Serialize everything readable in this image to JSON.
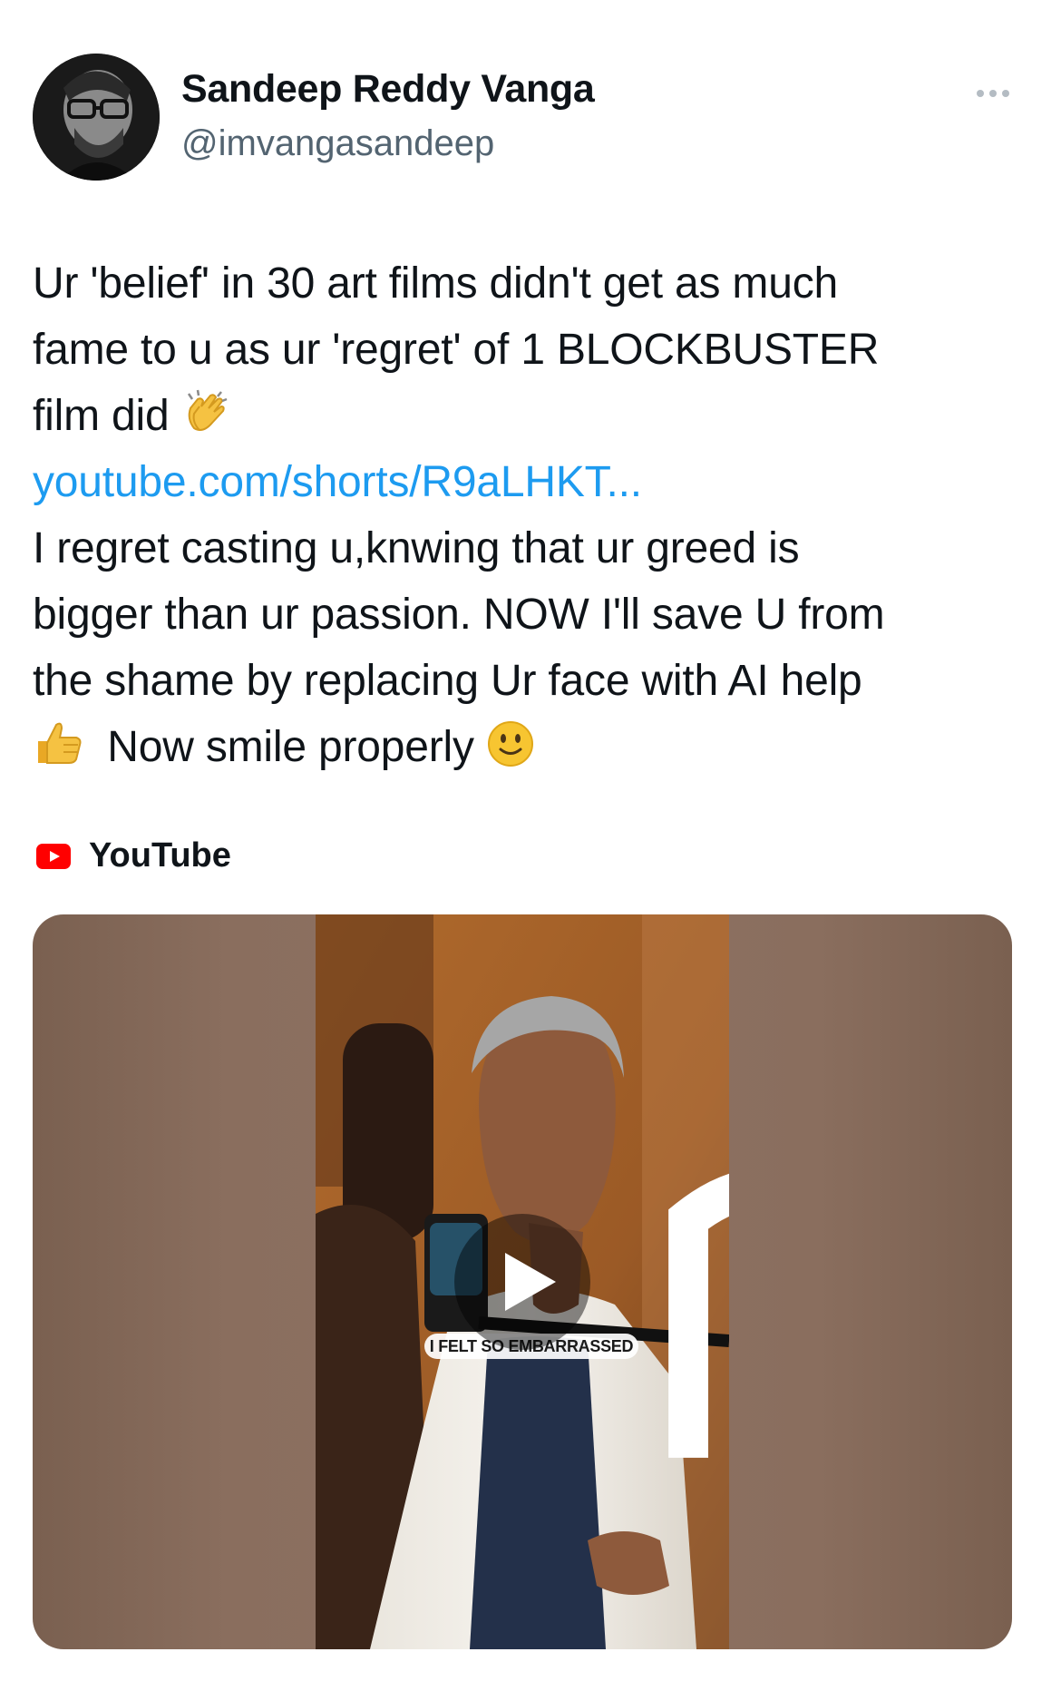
{
  "author": {
    "display_name": "Sandeep Reddy Vanga",
    "handle": "@imvangasandeep"
  },
  "tweet": {
    "lines": [
      "Ur 'belief' in 30 art films didn't get as much",
      "fame to u as ur 'regret' of 1 BLOCKBUSTER",
      "film did"
    ],
    "link_text": "youtube.com/shorts/R9aLHKT...",
    "lines_after": [
      "I regret casting u,knwing that ur greed is",
      "bigger than ur passion. NOW I'll save U from",
      "the shame by replacing Ur face with AI help"
    ],
    "last_line": "Now smile properly",
    "emojis": [
      "clapping-hands",
      "thumbs-up",
      "slightly-smiling-face"
    ]
  },
  "card": {
    "source_label": "YouTube",
    "video_caption": "I FELT SO EMBARRASSED",
    "icon": "play-icon"
  },
  "colors": {
    "link": "#1d9bf0",
    "secondary_text": "#536471",
    "youtube_red": "#ff0000"
  }
}
